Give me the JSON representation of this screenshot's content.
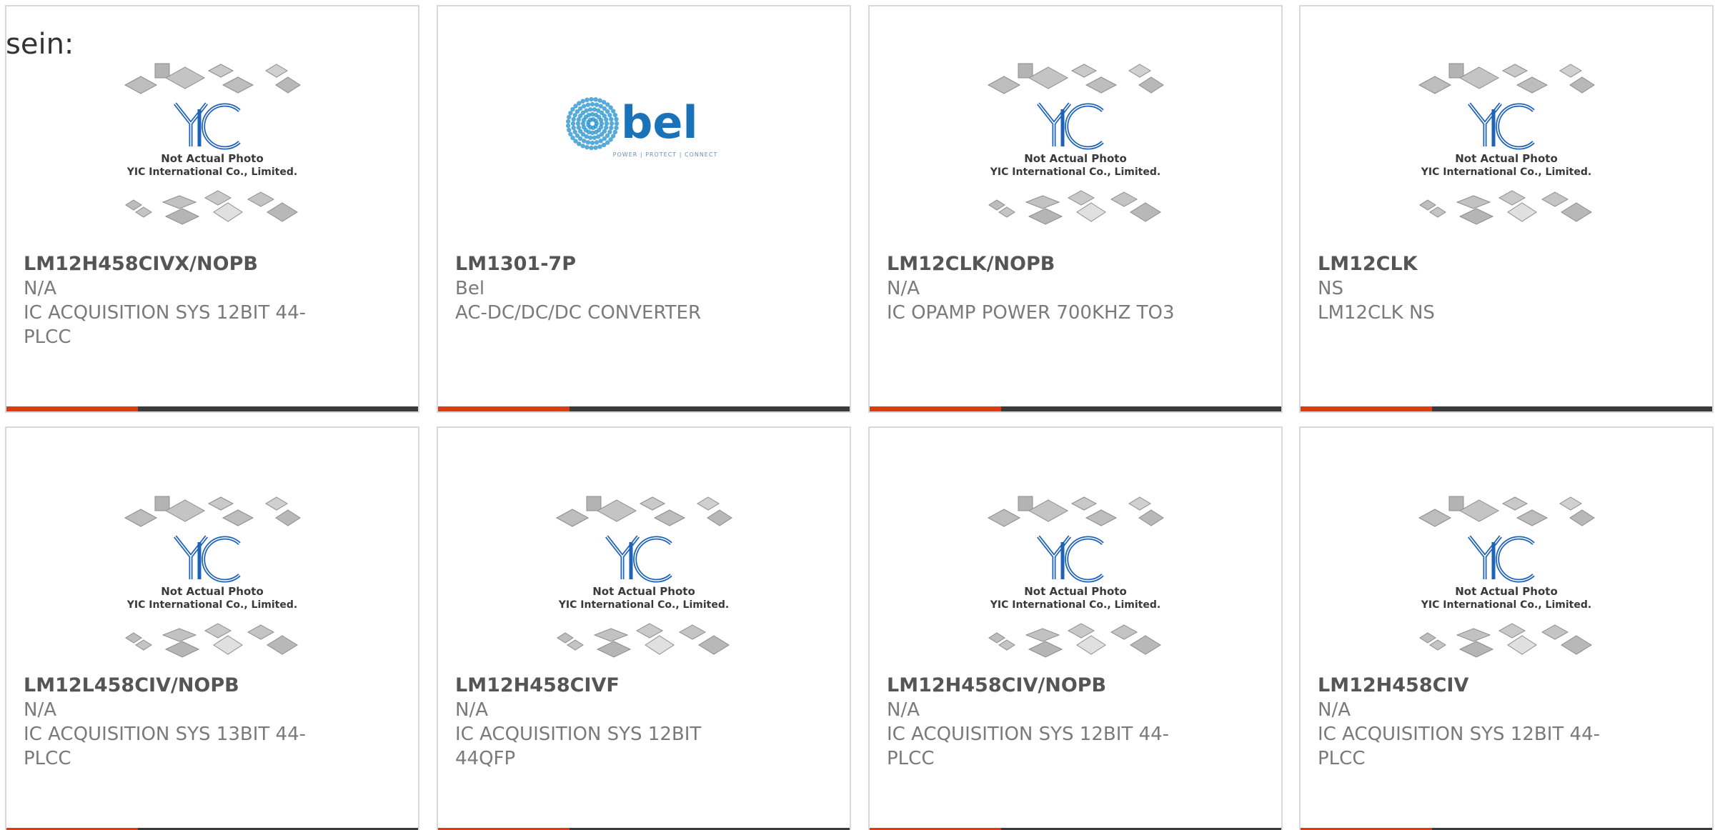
{
  "intro_text": "sein:",
  "placeholder_image": {
    "line1": "Not Actual Photo",
    "line2": "YIC International Co., Limited.",
    "logo_text": "YIC"
  },
  "bel_logo": {
    "brand": "bel",
    "tagline": "POWER | PROTECT | CONNECT"
  },
  "colors": {
    "accent": "#e03a12",
    "bar": "#3b3b3b",
    "part_text": "#555555",
    "meta_text": "#7a7a7a",
    "yic_blue": "#1e63b8",
    "bel_blue": "#1f8fce"
  },
  "products": [
    {
      "part": "LM12H458CIVX/NOPB",
      "maker": "N/A",
      "desc": "IC ACQUISITION SYS 12BIT 44-PLCC",
      "image": "yic-placeholder"
    },
    {
      "part": "LM1301-7P",
      "maker": "Bel",
      "desc": "AC-DC/DC/DC CONVERTER",
      "image": "bel-logo"
    },
    {
      "part": "LM12CLK/NOPB",
      "maker": "N/A",
      "desc": "IC OPAMP POWER 700KHZ TO3",
      "image": "yic-placeholder"
    },
    {
      "part": "LM12CLK",
      "maker": "NS",
      "desc": "LM12CLK NS",
      "image": "yic-placeholder"
    },
    {
      "part": "LM12L458CIV/NOPB",
      "maker": "N/A",
      "desc": "IC ACQUISITION SYS 13BIT 44-PLCC",
      "image": "yic-placeholder"
    },
    {
      "part": "LM12H458CIVF",
      "maker": "N/A",
      "desc": "IC ACQUISITION SYS 12BIT 44QFP",
      "image": "yic-placeholder"
    },
    {
      "part": "LM12H458CIV/NOPB",
      "maker": "N/A",
      "desc": "IC ACQUISITION SYS 12BIT 44-PLCC",
      "image": "yic-placeholder"
    },
    {
      "part": "LM12H458CIV",
      "maker": "N/A",
      "desc": "IC ACQUISITION SYS 12BIT 44-PLCC",
      "image": "yic-placeholder"
    }
  ]
}
